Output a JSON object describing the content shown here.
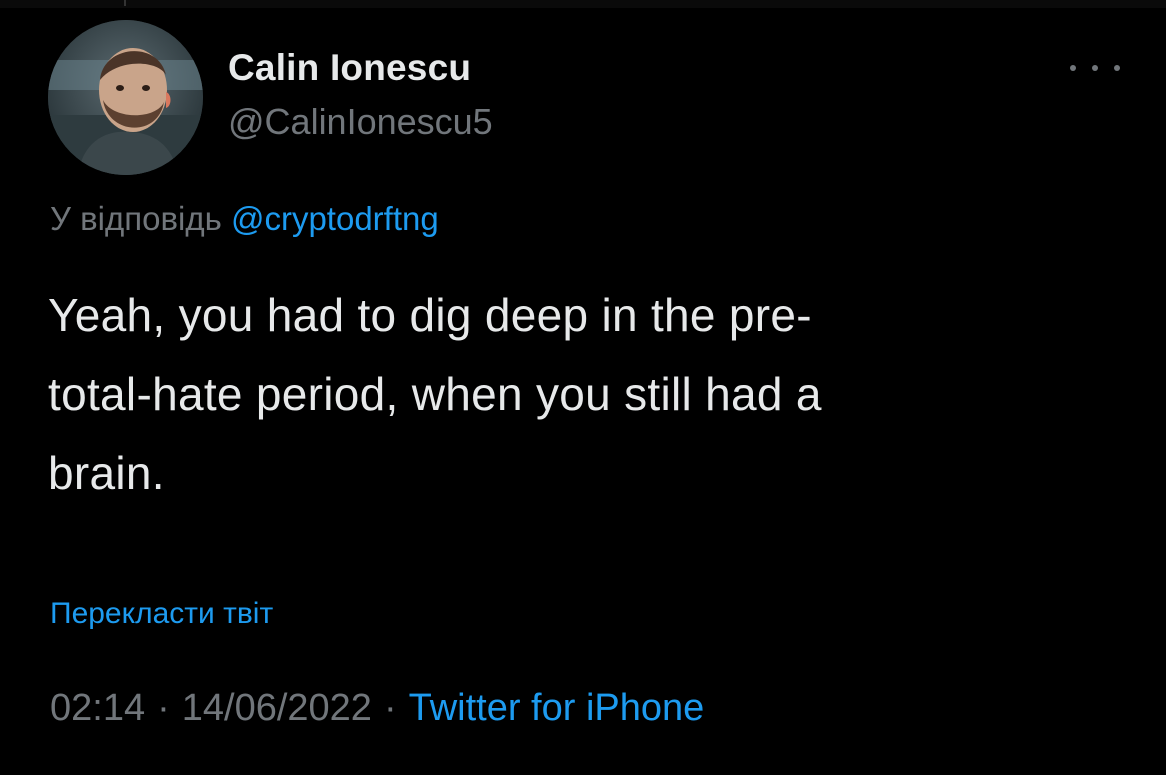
{
  "author": {
    "display_name": "Calin Ionescu",
    "handle": "@CalinIonescu5",
    "avatar_icon": "profile-photo"
  },
  "more_icon": "ellipsis-icon",
  "reply": {
    "prefix": "У відповідь",
    "mention": "@cryptodrftng"
  },
  "tweet": {
    "lines": [
      "Yeah, you had to dig deep in the pre-",
      "total-hate period, when you still had a",
      "brain."
    ]
  },
  "translate_label": "Перекласти твіт",
  "meta": {
    "time": "02:14",
    "separator": "·",
    "date": "14/06/2022",
    "source": "Twitter for iPhone"
  },
  "colors": {
    "background": "#000000",
    "text_primary": "#e7e9ea",
    "text_secondary": "#71767b",
    "accent": "#1d9bf0"
  }
}
